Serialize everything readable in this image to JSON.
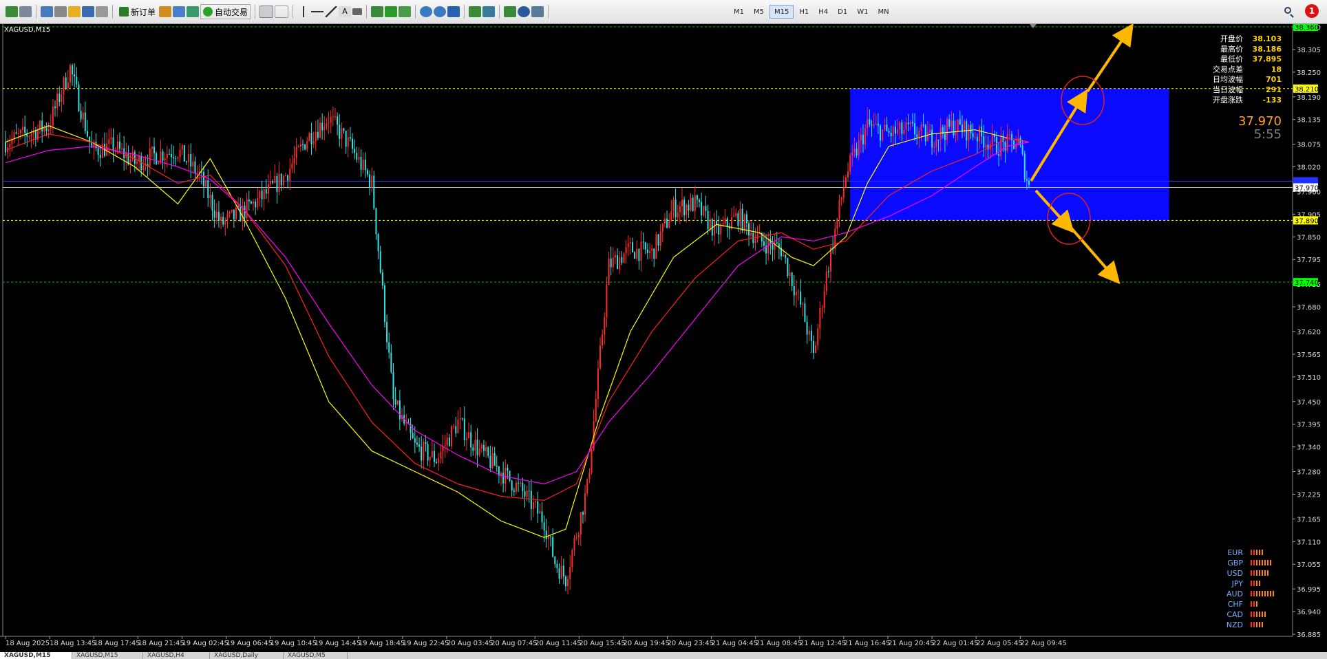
{
  "toolbar": {
    "new_order_label": "新订单",
    "auto_trade_label": "自动交易",
    "timeframes": [
      "M1",
      "M5",
      "M15",
      "H1",
      "H4",
      "D1",
      "W1",
      "MN"
    ],
    "active_timeframe": "M15",
    "notification_count": "1"
  },
  "symbol_label": "XAGUSD,M15",
  "info_panel": [
    {
      "label": "开盘价",
      "value": "38.103",
      "color": "#ffd400"
    },
    {
      "label": "最高价",
      "value": "38.186",
      "color": "#ffd400"
    },
    {
      "label": "最低价",
      "value": "37.895",
      "color": "#ffd400"
    },
    {
      "label": "交易点差",
      "value": "18",
      "color": "#ffd400"
    },
    {
      "label": "日均波幅",
      "value": "701",
      "color": "#ffd400"
    },
    {
      "label": "当日波幅",
      "value": "291",
      "color": "#ffd400"
    },
    {
      "label": "开盘涨跌",
      "value": "-133",
      "color": "#ffd400"
    }
  ],
  "current_price": "37.970",
  "countdown": "5:55",
  "currency_strength": [
    {
      "name": "EUR",
      "bars": 5
    },
    {
      "name": "GBP",
      "bars": 8
    },
    {
      "name": "USD",
      "bars": 7
    },
    {
      "name": "JPY",
      "bars": 4
    },
    {
      "name": "AUD",
      "bars": 9
    },
    {
      "name": "CHF",
      "bars": 3
    },
    {
      "name": "CAD",
      "bars": 6
    },
    {
      "name": "NZD",
      "bars": 5
    }
  ],
  "tabs": [
    "XAGUSD,M15",
    "XAGUSD,M15",
    "XAGUSD,H4",
    "XAGUSD,Daily",
    "XAGUSD,M5"
  ],
  "chart_data": {
    "type": "candlestick",
    "y_ticks": [
      "38.360",
      "38.305",
      "38.250",
      "38.190",
      "38.135",
      "38.075",
      "38.020",
      "37.960",
      "37.905",
      "37.850",
      "37.795",
      "37.735",
      "37.680",
      "37.620",
      "37.565",
      "37.510",
      "37.450",
      "37.395",
      "37.340",
      "37.280",
      "37.225",
      "37.165",
      "37.110",
      "37.055",
      "36.995",
      "36.940",
      "36.885"
    ],
    "ylim": [
      36.885,
      38.39
    ],
    "x_ticks": [
      "18 Aug 2025",
      "18 Aug 13:45",
      "18 Aug 17:45",
      "18 Aug 21:45",
      "19 Aug 02:45",
      "19 Aug 06:45",
      "19 Aug 10:45",
      "19 Aug 14:45",
      "19 Aug 18:45",
      "19 Aug 22:45",
      "20 Aug 03:45",
      "20 Aug 07:45",
      "20 Aug 11:45",
      "20 Aug 15:45",
      "20 Aug 19:45",
      "20 Aug 23:45",
      "21 Aug 04:45",
      "21 Aug 08:45",
      "21 Aug 12:45",
      "21 Aug 16:45",
      "21 Aug 20:45",
      "22 Aug 01:45",
      "22 Aug 05:45",
      "22 Aug 09:45"
    ],
    "price_path": [
      [
        0,
        38.08
      ],
      [
        10,
        38.1
      ],
      [
        20,
        38.12
      ],
      [
        30,
        38.26
      ],
      [
        40,
        38.06
      ],
      [
        50,
        38.07
      ],
      [
        60,
        38.03
      ],
      [
        70,
        38.05
      ],
      [
        80,
        38.06
      ],
      [
        90,
        38.0
      ],
      [
        100,
        37.88
      ],
      [
        110,
        37.91
      ],
      [
        120,
        37.95
      ],
      [
        130,
        38.0
      ],
      [
        140,
        38.09
      ],
      [
        150,
        38.14
      ],
      [
        160,
        38.07
      ],
      [
        170,
        37.98
      ],
      [
        180,
        37.45
      ],
      [
        190,
        37.34
      ],
      [
        200,
        37.31
      ],
      [
        210,
        37.4
      ],
      [
        220,
        37.33
      ],
      [
        230,
        37.28
      ],
      [
        240,
        37.23
      ],
      [
        250,
        37.16
      ],
      [
        255,
        37.06
      ],
      [
        260,
        37.02
      ],
      [
        270,
        37.24
      ],
      [
        280,
        37.78
      ],
      [
        290,
        37.82
      ],
      [
        300,
        37.81
      ],
      [
        310,
        37.92
      ],
      [
        320,
        37.93
      ],
      [
        330,
        37.86
      ],
      [
        340,
        37.9
      ],
      [
        350,
        37.84
      ],
      [
        360,
        37.82
      ],
      [
        370,
        37.67
      ],
      [
        375,
        37.56
      ],
      [
        380,
        37.73
      ],
      [
        390,
        38.0
      ],
      [
        400,
        38.12
      ],
      [
        410,
        38.1
      ],
      [
        420,
        38.11
      ],
      [
        430,
        38.09
      ],
      [
        440,
        38.12
      ],
      [
        450,
        38.1
      ],
      [
        460,
        38.07
      ],
      [
        470,
        38.08
      ],
      [
        475,
        37.97
      ]
    ],
    "moving_averages": [
      {
        "color": "#ffff00",
        "path": [
          [
            0,
            38.08
          ],
          [
            20,
            38.12
          ],
          [
            40,
            38.08
          ],
          [
            60,
            38.02
          ],
          [
            80,
            37.93
          ],
          [
            95,
            38.04
          ],
          [
            110,
            37.9
          ],
          [
            130,
            37.7
          ],
          [
            150,
            37.45
          ],
          [
            170,
            37.33
          ],
          [
            190,
            37.28
          ],
          [
            210,
            37.23
          ],
          [
            230,
            37.16
          ],
          [
            250,
            37.12
          ],
          [
            260,
            37.14
          ],
          [
            275,
            37.4
          ],
          [
            290,
            37.62
          ],
          [
            310,
            37.8
          ],
          [
            330,
            37.88
          ],
          [
            350,
            37.86
          ],
          [
            365,
            37.8
          ],
          [
            375,
            37.78
          ],
          [
            390,
            37.85
          ],
          [
            400,
            37.98
          ],
          [
            410,
            38.07
          ],
          [
            430,
            38.1
          ],
          [
            450,
            38.11
          ],
          [
            465,
            38.09
          ],
          [
            475,
            38.08
          ]
        ]
      },
      {
        "color": "#ff2020",
        "path": [
          [
            0,
            38.06
          ],
          [
            20,
            38.1
          ],
          [
            40,
            38.08
          ],
          [
            60,
            38.04
          ],
          [
            80,
            37.98
          ],
          [
            95,
            38.0
          ],
          [
            110,
            37.92
          ],
          [
            130,
            37.78
          ],
          [
            150,
            37.56
          ],
          [
            170,
            37.4
          ],
          [
            190,
            37.3
          ],
          [
            210,
            37.25
          ],
          [
            230,
            37.22
          ],
          [
            250,
            37.21
          ],
          [
            265,
            37.25
          ],
          [
            280,
            37.45
          ],
          [
            300,
            37.62
          ],
          [
            320,
            37.75
          ],
          [
            340,
            37.84
          ],
          [
            360,
            37.86
          ],
          [
            375,
            37.82
          ],
          [
            390,
            37.84
          ],
          [
            410,
            37.95
          ],
          [
            430,
            38.01
          ],
          [
            450,
            38.05
          ],
          [
            465,
            38.09
          ],
          [
            475,
            38.08
          ]
        ]
      },
      {
        "color": "#ff00ff",
        "path": [
          [
            0,
            38.03
          ],
          [
            20,
            38.06
          ],
          [
            40,
            38.07
          ],
          [
            60,
            38.05
          ],
          [
            80,
            38.02
          ],
          [
            95,
            37.99
          ],
          [
            110,
            37.92
          ],
          [
            130,
            37.8
          ],
          [
            150,
            37.64
          ],
          [
            170,
            37.49
          ],
          [
            190,
            37.38
          ],
          [
            210,
            37.32
          ],
          [
            230,
            37.27
          ],
          [
            250,
            37.25
          ],
          [
            265,
            37.28
          ],
          [
            280,
            37.4
          ],
          [
            300,
            37.52
          ],
          [
            320,
            37.65
          ],
          [
            340,
            37.78
          ],
          [
            360,
            37.85
          ],
          [
            375,
            37.84
          ],
          [
            390,
            37.86
          ],
          [
            410,
            37.9
          ],
          [
            430,
            37.95
          ],
          [
            450,
            38.02
          ],
          [
            465,
            38.07
          ],
          [
            475,
            38.08
          ]
        ]
      }
    ],
    "horizontal_lines": [
      {
        "price": 38.36,
        "label": "38.360",
        "color": "#00c000",
        "dashed": true,
        "label_bg": "#00ff00"
      },
      {
        "price": 38.21,
        "label": "38.210",
        "color": "#ffff00",
        "dashed": true,
        "label_bg": "#ffff00"
      },
      {
        "price": 37.985,
        "label": "",
        "color": "#2030ff",
        "dashed": false,
        "label_bg": "#2030ff"
      },
      {
        "price": 37.97,
        "label": "37.970",
        "color": "#c0c0c0",
        "dashed": false,
        "label_bg": "#ffffff"
      },
      {
        "price": 37.89,
        "label": "37.890",
        "color": "#ffff00",
        "dashed": true,
        "label_bg": "#ffff00"
      },
      {
        "price": 37.74,
        "label": "37.740",
        "color": "#00c000",
        "dashed": true,
        "label_bg": "#00ff00"
      }
    ],
    "range_box": {
      "x_from": 392,
      "x_to": 540,
      "y_from": 37.89,
      "y_to": 38.21,
      "color": "#0a0aff"
    }
  }
}
